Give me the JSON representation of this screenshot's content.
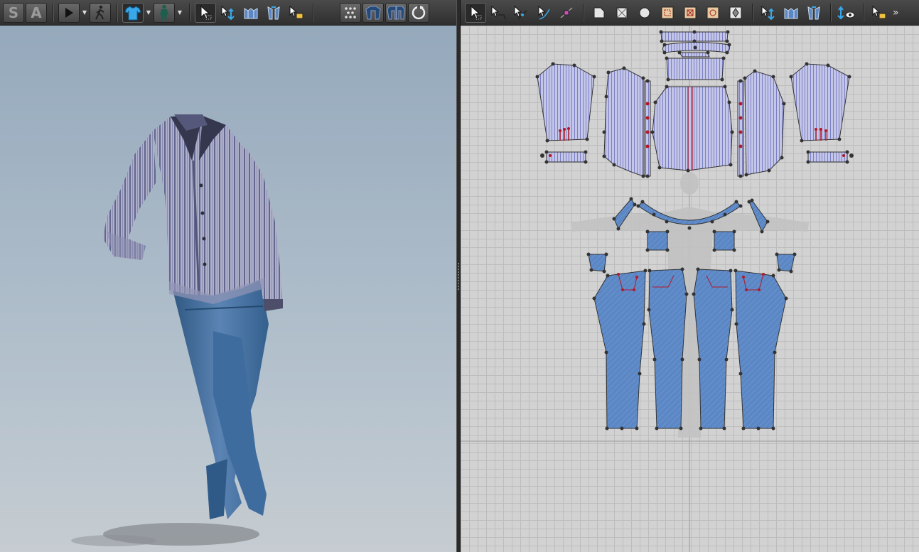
{
  "toolbar_left": {
    "simulation_mode_label": "S",
    "animation_mode_label": "A",
    "buttons": [
      "play-icon",
      "walk-icon",
      "shirt-icon",
      "avatar-icon",
      "select-icon",
      "transform-icon",
      "fold-icon",
      "arrange-icon",
      "selection-mode-icon",
      "points-icon",
      "garment-icon",
      "garments-icon",
      "reset-icon"
    ]
  },
  "toolbar_right": {
    "buttons": [
      "select-move-icon",
      "edit-pattern-icon",
      "edit-curve-icon",
      "edit-point-icon",
      "curve-point-icon",
      "polygon-icon",
      "rectangle-icon",
      "circle-icon",
      "internal-polygon-icon",
      "internal-rectangle-icon",
      "internal-circle-icon",
      "dart-icon",
      "segment-sewing-icon",
      "free-sewing-icon",
      "m-n-sewing-icon",
      "show-sewing-icon",
      "layout-icon"
    ],
    "more_label": "»"
  },
  "colors": {
    "shirt_fill": "#b9bbe0",
    "shirt_stripe": "#7c80c4",
    "jeans_fill": "#5b87c5",
    "point": "#333333",
    "notch": "#b01a2a",
    "grid": "#bdbdbd"
  }
}
